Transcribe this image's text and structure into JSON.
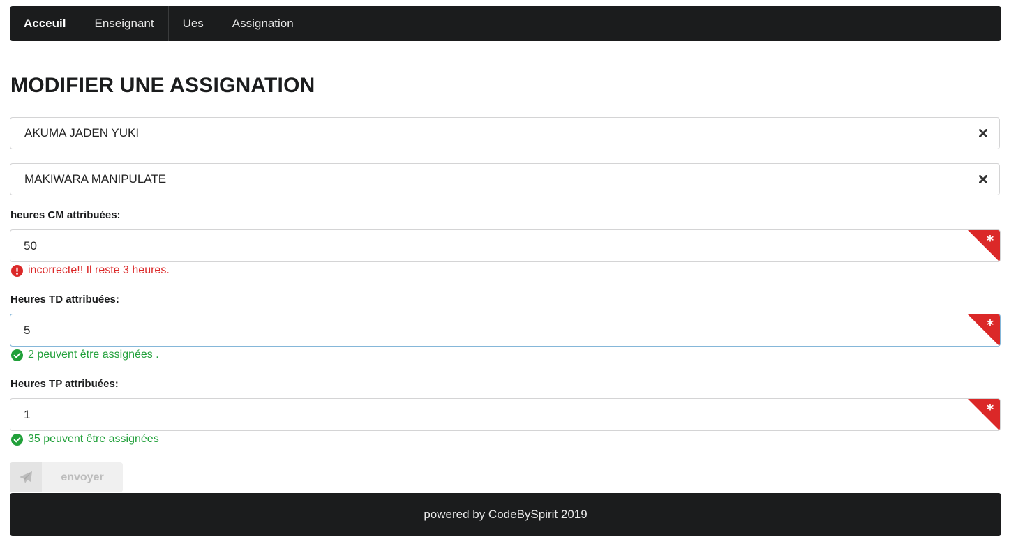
{
  "nav": {
    "items": [
      {
        "label": "Acceuil",
        "active": true
      },
      {
        "label": "Enseignant",
        "active": false
      },
      {
        "label": "Ues",
        "active": false
      },
      {
        "label": "Assignation",
        "active": false
      }
    ]
  },
  "page": {
    "title": "MODIFIER UNE ASSIGNATION"
  },
  "selects": {
    "teacher": {
      "value": "AKUMA JADEN YUKI",
      "clear_icon": "close-icon"
    },
    "ue": {
      "value": "MAKIWARA MANIPULATE",
      "clear_icon": "close-icon"
    }
  },
  "fields": {
    "cm": {
      "label": "heures CM attribuées:",
      "value": "50",
      "message": "incorrecte!! Il reste 3 heures.",
      "status": "error"
    },
    "td": {
      "label": "Heures TD attribuées:",
      "value": "5",
      "message": "2 peuvent être assignées .",
      "status": "ok"
    },
    "tp": {
      "label": "Heures TP attribuées:",
      "value": "1",
      "message": "35 peuvent être assignées",
      "status": "ok"
    }
  },
  "actions": {
    "send_label": "envoyer",
    "send_icon": "paper-plane-icon",
    "send_disabled": true
  },
  "footer": {
    "text": "powered by CodeBySpirit 2019"
  },
  "colors": {
    "navbar_bg": "#1b1c1d",
    "error": "#db2828",
    "success": "#21a03a",
    "required_corner": "#db2828",
    "focus_border": "#85b7d9"
  }
}
